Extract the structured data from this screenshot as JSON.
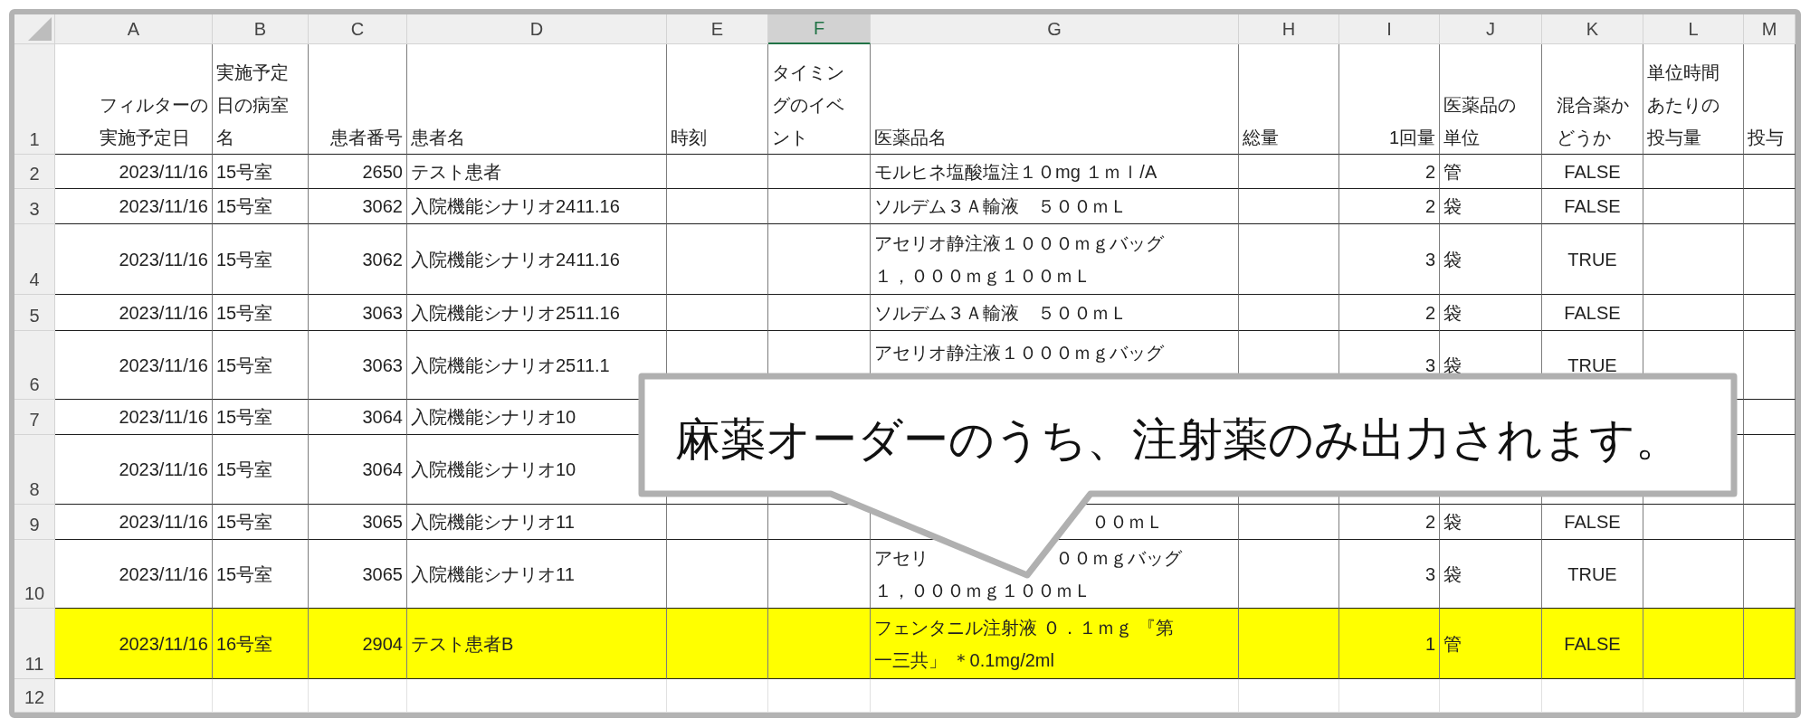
{
  "columns": [
    {
      "letter": "A",
      "selected": false
    },
    {
      "letter": "B",
      "selected": false
    },
    {
      "letter": "C",
      "selected": false
    },
    {
      "letter": "D",
      "selected": false
    },
    {
      "letter": "E",
      "selected": false
    },
    {
      "letter": "F",
      "selected": true
    },
    {
      "letter": "G",
      "selected": false
    },
    {
      "letter": "H",
      "selected": false
    },
    {
      "letter": "I",
      "selected": false
    },
    {
      "letter": "J",
      "selected": false
    },
    {
      "letter": "K",
      "selected": false
    },
    {
      "letter": "L",
      "selected": false
    },
    {
      "letter": "M",
      "selected": false
    }
  ],
  "rows": [
    {
      "number": "1",
      "highlighted": false,
      "cells": [
        [
          "フィルターの",
          "実施予定日"
        ],
        [
          "実施予定",
          "日の病室",
          "名"
        ],
        "患者番号",
        "患者名",
        "時刻",
        [
          "タイミン",
          "グのイベ",
          "ント"
        ],
        "医薬品名",
        "総量",
        "1回量",
        [
          "医薬品の",
          "単位"
        ],
        [
          "混合薬か",
          "どうか"
        ],
        [
          "単位時間",
          "あたりの",
          "投与量"
        ],
        "投与"
      ]
    },
    {
      "number": "2",
      "highlighted": false,
      "cells": [
        "2023/11/16",
        "15号室",
        "2650",
        "テスト患者",
        null,
        null,
        "モルヒネ塩酸塩注１０mg １ｍｌ/A",
        null,
        "2",
        "管",
        "FALSE",
        null,
        null
      ]
    },
    {
      "number": "3",
      "highlighted": false,
      "cells": [
        "2023/11/16",
        "15号室",
        "3062",
        "入院機能シナリオ2411.16",
        null,
        null,
        "ソルデム３Ａ輸液　５００ｍＬ",
        null,
        "2",
        "袋",
        "FALSE",
        null,
        null
      ]
    },
    {
      "number": "4",
      "highlighted": false,
      "cells": [
        "2023/11/16",
        "15号室",
        "3062",
        "入院機能シナリオ2411.16",
        null,
        null,
        [
          "アセリオ静注液１０００ｍｇバッグ",
          "１，０００ｍｇ１００ｍＬ"
        ],
        null,
        "3",
        "袋",
        "TRUE",
        null,
        null
      ]
    },
    {
      "number": "5",
      "highlighted": false,
      "cells": [
        "2023/11/16",
        "15号室",
        "3063",
        "入院機能シナリオ2511.16",
        null,
        null,
        "ソルデム３Ａ輸液　５００ｍＬ",
        null,
        "2",
        "袋",
        "FALSE",
        null,
        null
      ]
    },
    {
      "number": "6",
      "highlighted": false,
      "cells": [
        "2023/11/16",
        "15号室",
        "3063",
        "入院機能シナリオ2511.1",
        null,
        null,
        {
          "kind": "upper_line",
          "text": "アセリオ静注液１０００ｍｇバッグ"
        },
        null,
        "3",
        "袋",
        "TRUE",
        null,
        null
      ]
    },
    {
      "number": "7",
      "highlighted": false,
      "cells": [
        "2023/11/16",
        "15号室",
        "3064",
        "入院機能シナリオ10",
        null,
        null,
        null,
        null,
        null,
        null,
        null,
        null,
        null
      ]
    },
    {
      "number": "8",
      "highlighted": false,
      "cells": [
        "2023/11/16",
        "15号室",
        "3064",
        "入院機能シナリオ10",
        null,
        null,
        null,
        null,
        null,
        null,
        null,
        null,
        null
      ]
    },
    {
      "number": "9",
      "highlighted": false,
      "cells": [
        "2023/11/16",
        "15号室",
        "3065",
        "入院機能シナリオ11",
        null,
        null,
        {
          "kind": "after_tail",
          "text": "００ｍＬ"
        },
        null,
        "2",
        "袋",
        "FALSE",
        null,
        null
      ]
    },
    {
      "number": "10",
      "highlighted": false,
      "cells": [
        "2023/11/16",
        "15号室",
        "3065",
        "入院機能シナリオ11",
        null,
        null,
        {
          "kind": "split",
          "lines": [
            [
              "アセリ",
              "００ｍｇバッグ"
            ],
            [
              "１，０００ｍｇ１００ｍＬ"
            ]
          ]
        },
        null,
        "3",
        "袋",
        "TRUE",
        null,
        null
      ]
    },
    {
      "number": "11",
      "highlighted": true,
      "cells": [
        "2023/11/16",
        "16号室",
        "2904",
        "テスト患者B",
        null,
        null,
        [
          "フェンタニル注射液 ０．１ｍｇ 『第",
          "一三共」 ＊0.1mg/2ml"
        ],
        null,
        "1",
        "管",
        "FALSE",
        null,
        null
      ]
    },
    {
      "number": "12",
      "highlighted": false,
      "cells": [
        null,
        null,
        null,
        null,
        null,
        null,
        null,
        null,
        null,
        null,
        null,
        null,
        null
      ]
    }
  ],
  "callout": {
    "text": "麻薬オーダーのうち、注射薬のみ出力されます。"
  }
}
